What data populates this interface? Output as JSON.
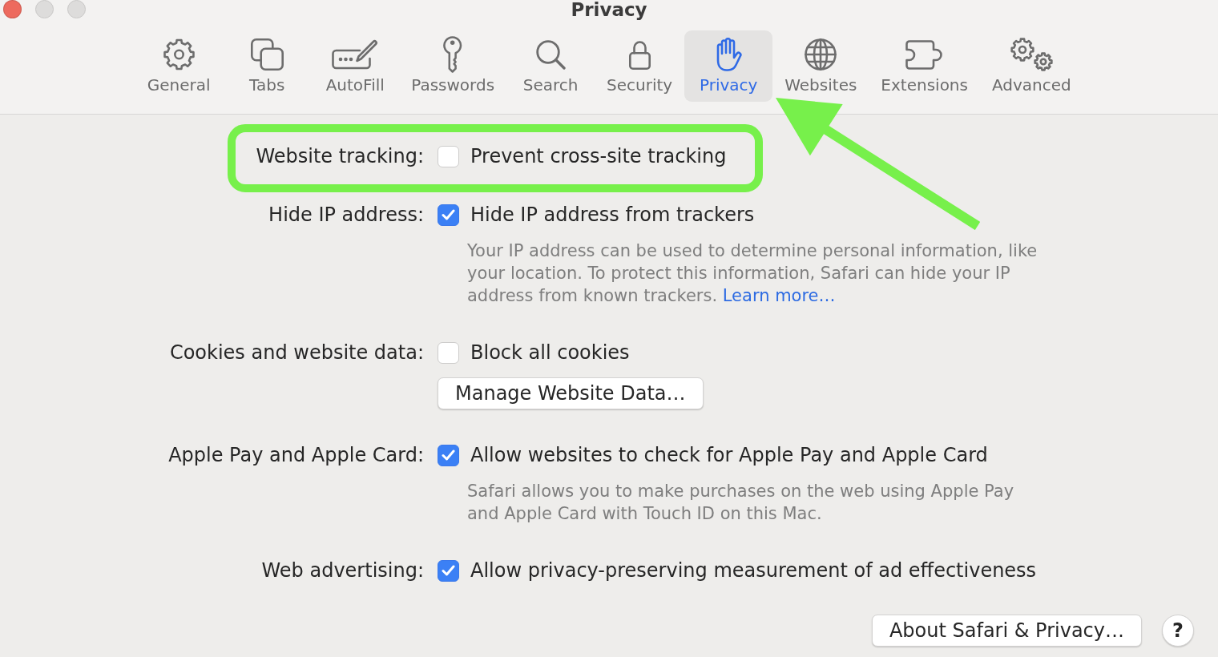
{
  "window": {
    "title": "Privacy",
    "controls": [
      {
        "disabled": false
      },
      {
        "disabled": true
      },
      {
        "disabled": true
      }
    ]
  },
  "toolbar": [
    {
      "label": "General",
      "selected": false
    },
    {
      "label": "Tabs",
      "selected": false
    },
    {
      "label": "AutoFill",
      "selected": false
    },
    {
      "label": "Passwords",
      "selected": false
    },
    {
      "label": "Search",
      "selected": false
    },
    {
      "label": "Security",
      "selected": false
    },
    {
      "label": "Privacy",
      "selected": true
    },
    {
      "label": "Websites",
      "selected": false
    },
    {
      "label": "Extensions",
      "selected": false
    },
    {
      "label": "Advanced",
      "selected": false
    }
  ],
  "settings": [
    {
      "label": "Website tracking:",
      "option": "Prevent cross-site tracking",
      "checked": false,
      "highlighted": true
    },
    {
      "label": "Hide IP address:",
      "option": "Hide IP address from trackers",
      "checked": true,
      "highlighted": false,
      "description": {
        "text": "Your IP address can be used to determine personal information, like your location. To protect this information, Safari can hide your IP address from known trackers.",
        "link": "Learn more…"
      }
    },
    {
      "label": "Cookies and website data:",
      "option": "Block all cookies",
      "checked": false,
      "highlighted": false,
      "button": "Manage Website Data…"
    },
    {
      "label": "Apple Pay and Apple Card:",
      "option": "Allow websites to check for Apple Pay and Apple Card",
      "checked": true,
      "highlighted": false,
      "description": {
        "text": "Safari allows you to make purchases on the web using Apple Pay and Apple Card with Touch ID on this Mac."
      }
    },
    {
      "label": "Web advertising:",
      "option": "Allow privacy-preserving measurement of ad effectiveness",
      "checked": true,
      "highlighted": false
    }
  ],
  "footer": {
    "button": "About Safari & Privacy…",
    "help": "?"
  }
}
